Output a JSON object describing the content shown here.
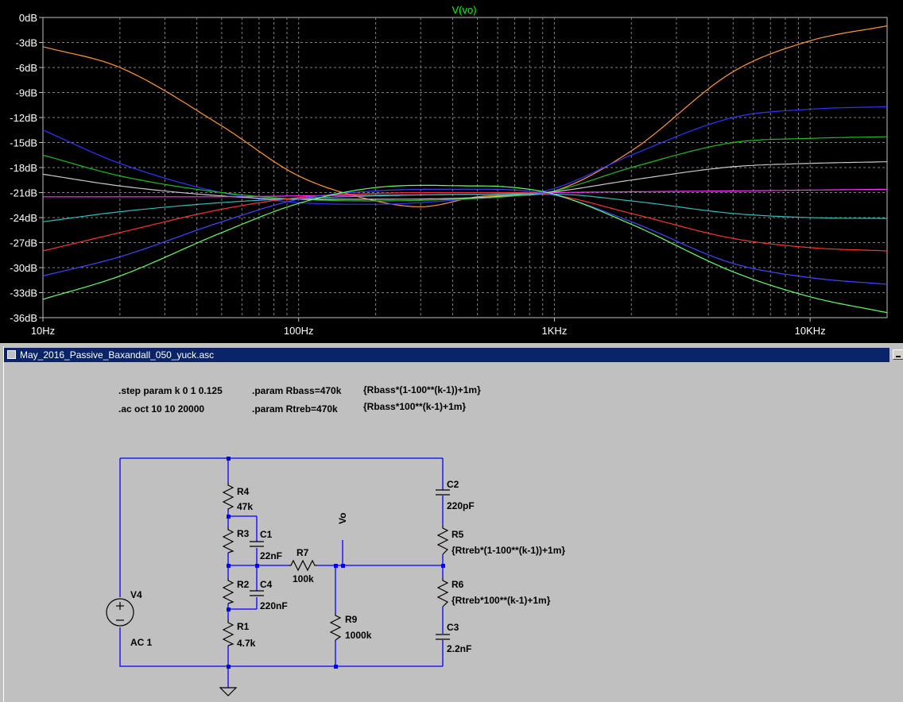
{
  "plot": {
    "trace_label": "V(vo)",
    "trace_label_color": "#00ff00",
    "background": "#000000",
    "grid_color": "#808080",
    "y_ticks": [
      "0dB",
      "-3dB",
      "-6dB",
      "-9dB",
      "-12dB",
      "-15dB",
      "-18dB",
      "-21dB",
      "-24dB",
      "-27dB",
      "-30dB",
      "-33dB",
      "-36dB"
    ],
    "x_ticks": [
      {
        "label": "10Hz",
        "f": 10
      },
      {
        "label": "100Hz",
        "f": 100
      },
      {
        "label": "1KHz",
        "f": 1000
      },
      {
        "label": "10KHz",
        "f": 10000
      }
    ]
  },
  "chart_data": {
    "type": "line",
    "title": "V(vo)",
    "x_scale": "log",
    "xlim": [
      10,
      20000
    ],
    "ylim": [
      -36,
      0
    ],
    "y_unit": "dB",
    "grid": true,
    "series": [
      {
        "color": "#ff9933",
        "x": [
          10,
          20,
          50,
          100,
          200,
          300,
          500,
          1000,
          2000,
          5000,
          10000,
          20000
        ],
        "y": [
          -3.5,
          -6,
          -13,
          -19,
          -22,
          -22.7,
          -21.5,
          -20.8,
          -16,
          -6.5,
          -2.8,
          -1
        ]
      },
      {
        "color": "#3333ff",
        "x": [
          10,
          20,
          50,
          100,
          200,
          500,
          700,
          1000,
          2000,
          5000,
          10000,
          20000
        ],
        "y": [
          -13.5,
          -17.5,
          -21,
          -22.2,
          -22.4,
          -21.7,
          -21.3,
          -20.5,
          -16.5,
          -12,
          -11,
          -10.7
        ]
      },
      {
        "color": "#22bb22",
        "x": [
          10,
          20,
          50,
          100,
          200,
          500,
          700,
          1000,
          2000,
          5000,
          10000,
          20000
        ],
        "y": [
          -16.5,
          -19,
          -21,
          -21.8,
          -22,
          -21.7,
          -21.4,
          -20.8,
          -18,
          -15,
          -14.5,
          -14.3
        ]
      },
      {
        "color": "#c8c8c8",
        "x": [
          10,
          20,
          50,
          100,
          200,
          500,
          700,
          1000,
          2000,
          5000,
          10000,
          20000
        ],
        "y": [
          -18.8,
          -20.2,
          -21.4,
          -21.8,
          -21.8,
          -21.6,
          -21.3,
          -20.9,
          -19.5,
          -17.9,
          -17.5,
          -17.3
        ]
      },
      {
        "color": "#ff33ff",
        "x": [
          10,
          20,
          50,
          100,
          200,
          500,
          1000,
          2000,
          5000,
          10000,
          20000
        ],
        "y": [
          -21.5,
          -21.5,
          -21.5,
          -21.4,
          -21.3,
          -21.2,
          -21,
          -20.9,
          -20.8,
          -20.7,
          -20.6
        ]
      },
      {
        "color": "#33bbbb",
        "x": [
          10,
          20,
          50,
          100,
          200,
          500,
          700,
          1000,
          2000,
          5000,
          10000,
          20000
        ],
        "y": [
          -24.5,
          -23.3,
          -22.2,
          -21.7,
          -21.4,
          -21.2,
          -21.2,
          -21.2,
          -22,
          -23.5,
          -24,
          -24.1
        ]
      },
      {
        "color": "#ff3333",
        "x": [
          10,
          20,
          50,
          100,
          200,
          500,
          700,
          1000,
          2000,
          5000,
          10000,
          20000
        ],
        "y": [
          -28,
          -25.8,
          -23,
          -21.6,
          -21.1,
          -21,
          -21,
          -21.3,
          -23.5,
          -26.5,
          -27.6,
          -28
        ]
      },
      {
        "color": "#4444ff",
        "x": [
          10,
          20,
          50,
          100,
          200,
          500,
          700,
          1000,
          2000,
          5000,
          10000,
          20000
        ],
        "y": [
          -31,
          -28.7,
          -24.5,
          -21.8,
          -20.8,
          -20.6,
          -20.7,
          -21.3,
          -24.5,
          -29.5,
          -31.2,
          -32
        ]
      },
      {
        "color": "#66ff66",
        "x": [
          10,
          20,
          50,
          100,
          200,
          500,
          700,
          1000,
          2000,
          5000,
          10000,
          20000
        ],
        "y": [
          -33.8,
          -31,
          -25.8,
          -22.3,
          -20.4,
          -20.2,
          -20.4,
          -21.2,
          -24.8,
          -30.5,
          -33.5,
          -35.4
        ]
      }
    ]
  },
  "schematic": {
    "window_title": "May_2016_Passive_Baxandall_050_yuck.asc",
    "directives": [
      ".step param k 0 1 0.125",
      ".ac oct 10 10 20000",
      ".param Rbass=470k",
      ".param Rtreb=470k",
      "{Rbass*(1-100**(k-1))+1m}",
      "{Rbass*100**(k-1)+1m}"
    ],
    "net_label": "Vo",
    "components": {
      "R4": {
        "name": "R4",
        "value": "47k"
      },
      "R3": {
        "name": "R3",
        "value": ""
      },
      "C1": {
        "name": "C1",
        "value": "22nF"
      },
      "R7": {
        "name": "R7",
        "value": "100k"
      },
      "R2": {
        "name": "R2",
        "value": ""
      },
      "C4": {
        "name": "C4",
        "value": "220nF"
      },
      "R1": {
        "name": "R1",
        "value": "4.7k"
      },
      "R9": {
        "name": "R9",
        "value": "1000k"
      },
      "C2": {
        "name": "C2",
        "value": "220pF"
      },
      "R5": {
        "name": "R5",
        "value": "{Rtreb*(1-100**(k-1))+1m}"
      },
      "R6": {
        "name": "R6",
        "value": "{Rtreb*100**(k-1)+1m}"
      },
      "C3": {
        "name": "C3",
        "value": "2.2nF"
      },
      "V4": {
        "name": "V4",
        "value": "AC 1"
      }
    }
  }
}
